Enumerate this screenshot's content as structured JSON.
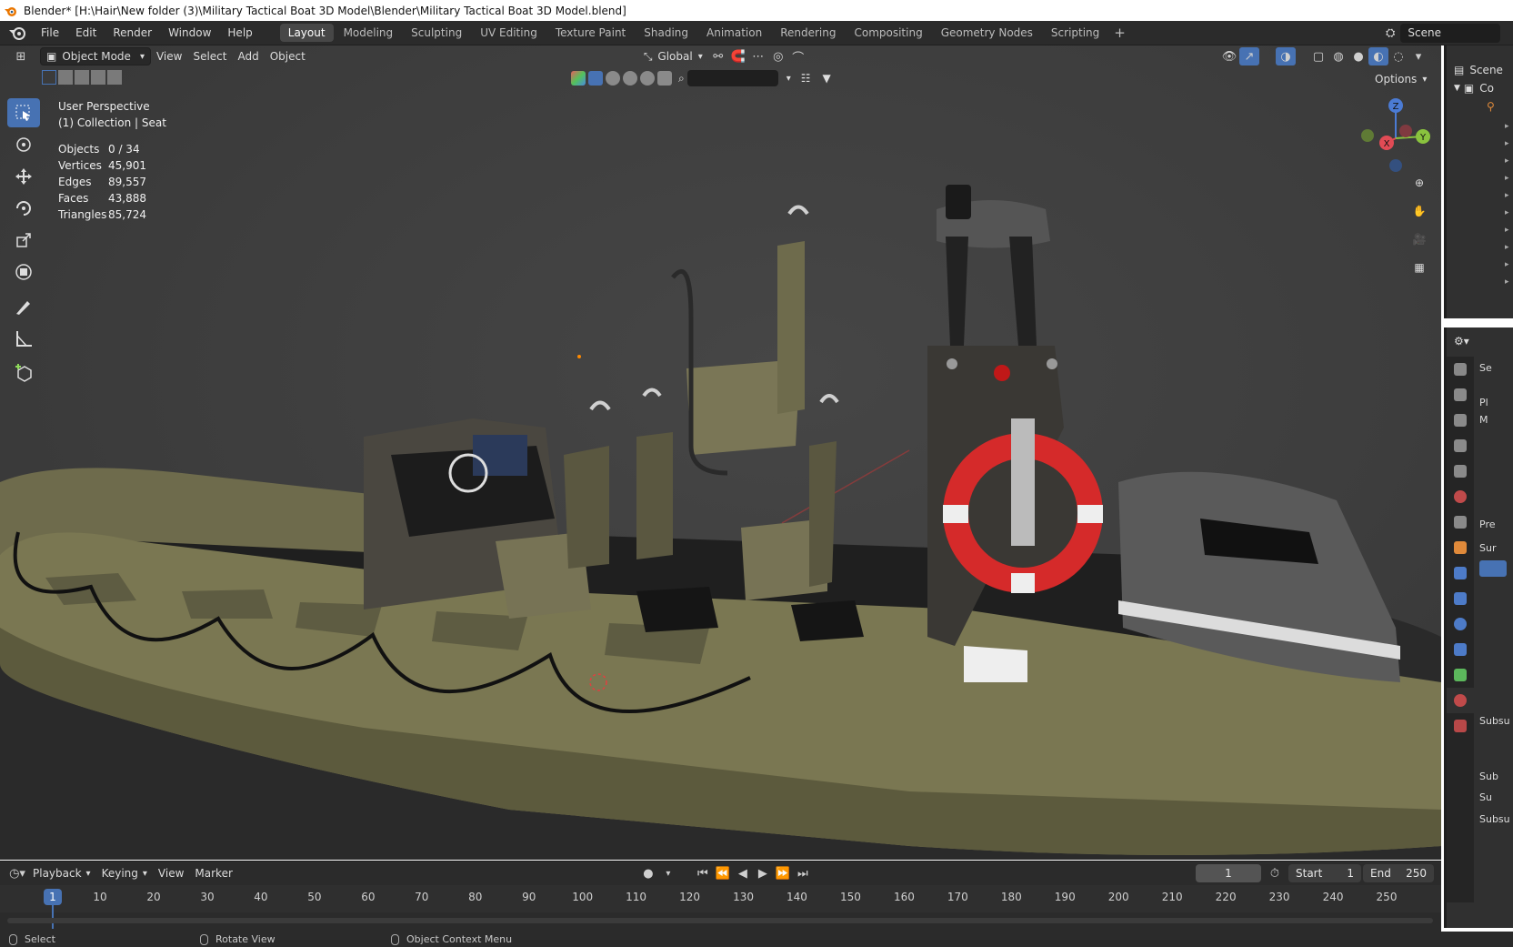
{
  "window": {
    "title": "Blender* [H:\\Hair\\New folder (3)\\Military Tactical Boat 3D Model\\Blender\\Military Tactical Boat 3D Model.blend]"
  },
  "menu": [
    "File",
    "Edit",
    "Render",
    "Window",
    "Help"
  ],
  "workspaces": [
    {
      "label": "Layout",
      "active": true
    },
    {
      "label": "Modeling"
    },
    {
      "label": "Sculpting"
    },
    {
      "label": "UV Editing"
    },
    {
      "label": "Texture Paint"
    },
    {
      "label": "Shading"
    },
    {
      "label": "Animation"
    },
    {
      "label": "Rendering"
    },
    {
      "label": "Compositing"
    },
    {
      "label": "Geometry Nodes"
    },
    {
      "label": "Scripting"
    }
  ],
  "scene": {
    "name": "Scene"
  },
  "viewport_header": {
    "mode": "Object Mode",
    "menus": [
      "View",
      "Select",
      "Add",
      "Object"
    ],
    "orientation": "Global",
    "options_label": "Options"
  },
  "overlay": {
    "view_name": "User Perspective",
    "collection": "(1) Collection | Seat"
  },
  "stats": [
    {
      "label": "Objects",
      "value": "0 / 34"
    },
    {
      "label": "Vertices",
      "value": "45,901"
    },
    {
      "label": "Edges",
      "value": "89,557"
    },
    {
      "label": "Faces",
      "value": "43,888"
    },
    {
      "label": "Triangles",
      "value": "85,724"
    }
  ],
  "gizmo": {
    "x": "X",
    "y": "Y",
    "z": "Z"
  },
  "outliner": {
    "scene_label": "Scene",
    "collection_label": "Co"
  },
  "properties": {
    "object_label": "Se",
    "material_1": "Pl",
    "material_2": "M",
    "preview": "Pre",
    "surface": "Sur",
    "sub1": "Subsu",
    "sub2": "Sub",
    "sub3": "Su",
    "sub4": "Subsu"
  },
  "timeline": {
    "menus": [
      "Playback",
      "Keying",
      "View",
      "Marker"
    ],
    "current_frame": "1",
    "start_label": "Start",
    "start_value": "1",
    "end_label": "End",
    "end_value": "250",
    "ticks": [
      "1",
      "10",
      "20",
      "30",
      "40",
      "50",
      "60",
      "70",
      "80",
      "90",
      "100",
      "110",
      "120",
      "130",
      "140",
      "150",
      "160",
      "170",
      "180",
      "190",
      "200",
      "210",
      "220",
      "230",
      "240",
      "250"
    ]
  },
  "statusbar": {
    "select": "Select",
    "rotate": "Rotate View",
    "context": "Object Context Menu"
  }
}
